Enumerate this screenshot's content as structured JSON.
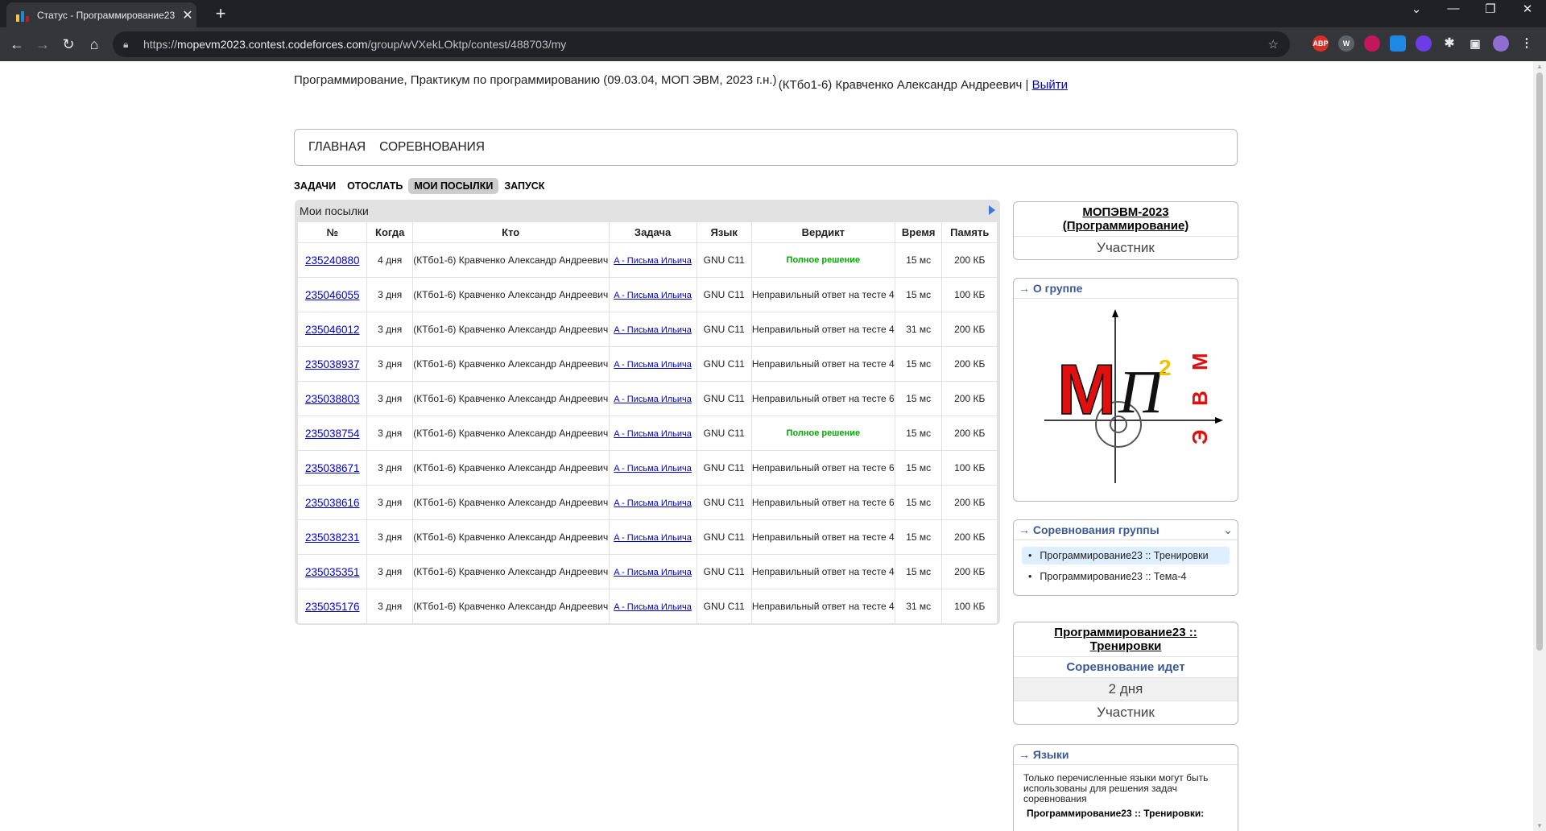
{
  "browser": {
    "tab_title": "Статус - Программирование23",
    "url_prefix": "https://",
    "url_host": "mopevm2023.contest.codeforces.com",
    "url_path": "/group/wVXekLOktp/contest/488703/my",
    "new_tab": "+",
    "minimize": "—",
    "restore": "❐",
    "close": "✕",
    "dropdown": "⌄"
  },
  "header": {
    "course": "Программирование, Практикум по программированию (09.03.04, МОП ЭВМ, 2023 г.н.)",
    "user": "(КТбо1-6) Кравченко Александр Андреевич",
    "separator": "|",
    "logout": "Выйти"
  },
  "main_menu": [
    "ГЛАВНАЯ",
    "СОРЕВНОВАНИЯ"
  ],
  "second_menu": [
    "ЗАДАЧИ",
    "ОТОСЛАТЬ",
    "МОИ ПОСЫЛКИ",
    "ЗАПУСК"
  ],
  "submissions": {
    "title": "Мои посылки",
    "columns": [
      "№",
      "Когда",
      "Кто",
      "Задача",
      "Язык",
      "Вердикт",
      "Время",
      "Память"
    ],
    "rows": [
      {
        "id": "235240880",
        "when": "4 дня",
        "who": "(КТбо1-6) Кравченко Александр Андреевич",
        "problem": "A - Письма Ильича",
        "lang": "GNU C11",
        "verdict": "Полное решение",
        "ok": true,
        "time": "15 мс",
        "mem": "200 КБ"
      },
      {
        "id": "235046055",
        "when": "3 дня",
        "who": "(КТбо1-6) Кравченко Александр Андреевич",
        "problem": "A - Письма Ильича",
        "lang": "GNU C11",
        "verdict": "Неправильный ответ на тесте 4",
        "ok": false,
        "time": "15 мс",
        "mem": "100 КБ"
      },
      {
        "id": "235046012",
        "when": "3 дня",
        "who": "(КТбо1-6) Кравченко Александр Андреевич",
        "problem": "A - Письма Ильича",
        "lang": "GNU C11",
        "verdict": "Неправильный ответ на тесте 4",
        "ok": false,
        "time": "31 мс",
        "mem": "200 КБ"
      },
      {
        "id": "235038937",
        "when": "3 дня",
        "who": "(КТбо1-6) Кравченко Александр Андреевич",
        "problem": "A - Письма Ильича",
        "lang": "GNU C11",
        "verdict": "Неправильный ответ на тесте 4",
        "ok": false,
        "time": "15 мс",
        "mem": "200 КБ"
      },
      {
        "id": "235038803",
        "when": "3 дня",
        "who": "(КТбо1-6) Кравченко Александр Андреевич",
        "problem": "A - Письма Ильича",
        "lang": "GNU C11",
        "verdict": "Неправильный ответ на тесте 6",
        "ok": false,
        "time": "15 мс",
        "mem": "200 КБ"
      },
      {
        "id": "235038754",
        "when": "3 дня",
        "who": "(КТбо1-6) Кравченко Александр Андреевич",
        "problem": "A - Письма Ильича",
        "lang": "GNU C11",
        "verdict": "Полное решение",
        "ok": true,
        "time": "15 мс",
        "mem": "200 КБ"
      },
      {
        "id": "235038671",
        "when": "3 дня",
        "who": "(КТбо1-6) Кравченко Александр Андреевич",
        "problem": "A - Письма Ильича",
        "lang": "GNU C11",
        "verdict": "Неправильный ответ на тесте 6",
        "ok": false,
        "time": "15 мс",
        "mem": "100 КБ"
      },
      {
        "id": "235038616",
        "when": "3 дня",
        "who": "(КТбо1-6) Кравченко Александр Андреевич",
        "problem": "A - Письма Ильича",
        "lang": "GNU C11",
        "verdict": "Неправильный ответ на тесте 6",
        "ok": false,
        "time": "15 мс",
        "mem": "200 КБ"
      },
      {
        "id": "235038231",
        "when": "3 дня",
        "who": "(КТбо1-6) Кравченко Александр Андреевич",
        "problem": "A - Письма Ильича",
        "lang": "GNU C11",
        "verdict": "Неправильный ответ на тесте 4",
        "ok": false,
        "time": "15 мс",
        "mem": "200 КБ"
      },
      {
        "id": "235035351",
        "when": "3 дня",
        "who": "(КТбо1-6) Кравченко Александр Андреевич",
        "problem": "A - Письма Ильича",
        "lang": "GNU C11",
        "verdict": "Неправильный ответ на тесте 4",
        "ok": false,
        "time": "15 мс",
        "mem": "200 КБ"
      },
      {
        "id": "235035176",
        "when": "3 дня",
        "who": "(КТбо1-6) Кравченко Александр Андреевич",
        "problem": "A - Письма Ильича",
        "lang": "GNU C11",
        "verdict": "Неправильный ответ на тесте 4",
        "ok": false,
        "time": "31 мс",
        "mem": "100 КБ"
      }
    ]
  },
  "sidebar": {
    "group_name": "МОПЭВМ-2023 (Программирование)",
    "group_role": "Участник",
    "about_title": "→ О группе",
    "logo_letters": [
      "М",
      "П",
      "2",
      "В",
      "М",
      "Э"
    ],
    "group_contests_title": "→ Соревнования группы",
    "group_contests": [
      "Программирование23 :: Тренировки",
      "Программирование23 :: Тема-4"
    ],
    "contest_name": "Программирование23 :: Тренировки",
    "contest_status": "Соревнование идет",
    "contest_remaining": "2 дня",
    "contest_role": "Участник",
    "languages_title": "→ Языки",
    "languages_note": "Только перечисленные языки могут быть использованы для решения задач соревнования",
    "languages_contest": "Программирование23 :: Тренировки:"
  },
  "colors": {
    "accepted": "#00aa00",
    "rejected": "#0000aa",
    "link": "#0000cc",
    "sidebar_title": "#3b5998"
  }
}
